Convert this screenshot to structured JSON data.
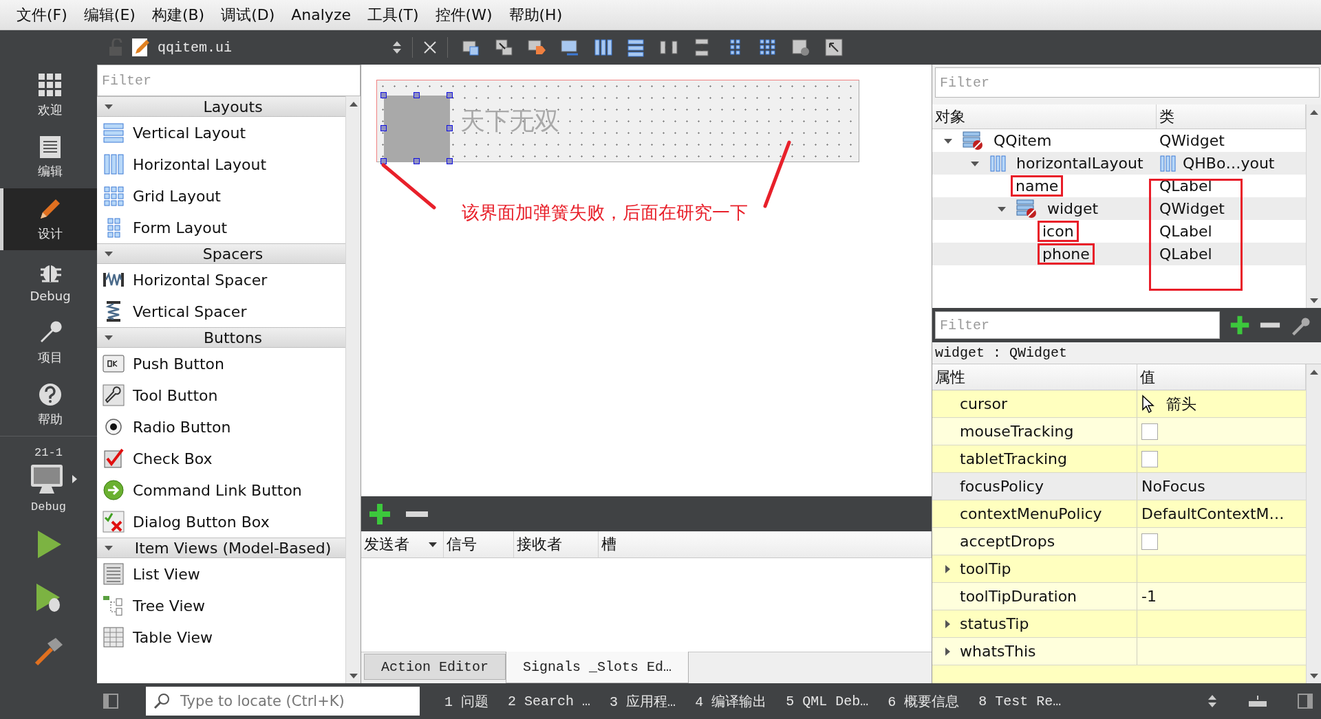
{
  "menu": [
    "文件(F)",
    "编辑(E)",
    "构建(B)",
    "调试(D)",
    "Analyze",
    "工具(T)",
    "控件(W)",
    "帮助(H)"
  ],
  "toolbar": {
    "file_name": "qqitem.ui"
  },
  "modes": [
    {
      "label": "欢迎",
      "selected": false
    },
    {
      "label": "编辑",
      "selected": false
    },
    {
      "label": "设计",
      "selected": true
    },
    {
      "label": "Debug",
      "selected": false
    },
    {
      "label": "项目",
      "selected": false
    },
    {
      "label": "帮助",
      "selected": false
    }
  ],
  "kit": {
    "project": "21-1",
    "build": "Debug"
  },
  "widget_box": {
    "filter_placeholder": "Filter",
    "categories": [
      {
        "title": "Layouts",
        "expanded": true,
        "items": [
          "Vertical Layout",
          "Horizontal Layout",
          "Grid Layout",
          "Form Layout"
        ]
      },
      {
        "title": "Spacers",
        "expanded": true,
        "items": [
          "Horizontal Spacer",
          "Vertical Spacer"
        ]
      },
      {
        "title": "Buttons",
        "expanded": true,
        "items": [
          "Push Button",
          "Tool Button",
          "Radio Button",
          "Check Box",
          "Command Link Button",
          "Dialog Button Box"
        ]
      },
      {
        "title": "Item Views (Model-Based)",
        "expanded": true,
        "items": [
          "List View",
          "Tree View",
          "Table View"
        ]
      }
    ]
  },
  "form": {
    "icon_label_selected": true,
    "name_label": "天下无双",
    "annotation": "该界面加弹簧失败，后面在研究一下"
  },
  "signal_slot_editor": {
    "columns": [
      "发送者",
      "信号",
      "接收者",
      "槽"
    ]
  },
  "bottom_tabs": [
    {
      "label": "Action Editor",
      "selected": false
    },
    {
      "label": "Signals _Slots Ed…",
      "selected": true
    }
  ],
  "object_inspector": {
    "filter_placeholder": "Filter",
    "columns": [
      "对象",
      "类"
    ],
    "class_column_marked": true,
    "tree": [
      {
        "object": "QQitem",
        "class": "QWidget",
        "kind": "widget",
        "expanded": true,
        "marked": false,
        "children": [
          {
            "object": "horizontalLayout",
            "class": "QHBo…yout",
            "kind": "layout",
            "expanded": true,
            "marked": false,
            "children": [
              {
                "object": "name",
                "class": "QLabel",
                "marked": true
              },
              {
                "object": "widget",
                "class": "QWidget",
                "kind": "widget",
                "expanded": true,
                "marked": false,
                "children": [
                  {
                    "object": "icon",
                    "class": "QLabel",
                    "marked": true
                  },
                  {
                    "object": "phone",
                    "class": "QLabel",
                    "marked": true
                  }
                ]
              }
            ]
          }
        ]
      }
    ]
  },
  "property_editor": {
    "filter_placeholder": "Filter",
    "subject": "widget : QWidget",
    "columns": [
      "属性",
      "值"
    ],
    "rows": [
      {
        "kind": "cursor",
        "name": "cursor",
        "value": "箭头",
        "selected": false
      },
      {
        "kind": "checkbox",
        "name": "mouseTracking",
        "checked": false,
        "selected": false
      },
      {
        "kind": "checkbox",
        "name": "tabletTracking",
        "checked": false,
        "selected": false
      },
      {
        "kind": "text",
        "name": "focusPolicy",
        "value": "NoFocus",
        "selected": true
      },
      {
        "kind": "text",
        "name": "contextMenuPolicy",
        "value": "DefaultContextM…",
        "selected": false
      },
      {
        "kind": "checkbox",
        "name": "acceptDrops",
        "checked": false,
        "selected": false
      },
      {
        "kind": "group",
        "name": "toolTip",
        "expanded": false,
        "selected": false
      },
      {
        "kind": "text",
        "name": "toolTipDuration",
        "value": "-1",
        "selected": false
      },
      {
        "kind": "group",
        "name": "statusTip",
        "expanded": false,
        "selected": false
      },
      {
        "kind": "group",
        "name": "whatsThis",
        "expanded": false,
        "selected": false
      }
    ]
  },
  "locator": {
    "placeholder": "Type to locate (Ctrl+K)"
  },
  "output_panes": [
    {
      "number": "1",
      "label": "问题"
    },
    {
      "number": "2",
      "label": "Search …"
    },
    {
      "number": "3",
      "label": "应用程…"
    },
    {
      "number": "4",
      "label": "编译输出"
    },
    {
      "number": "5",
      "label": "QML Deb…"
    },
    {
      "number": "6",
      "label": "概要信息"
    },
    {
      "number": "8",
      "label": "Test Re…"
    }
  ]
}
